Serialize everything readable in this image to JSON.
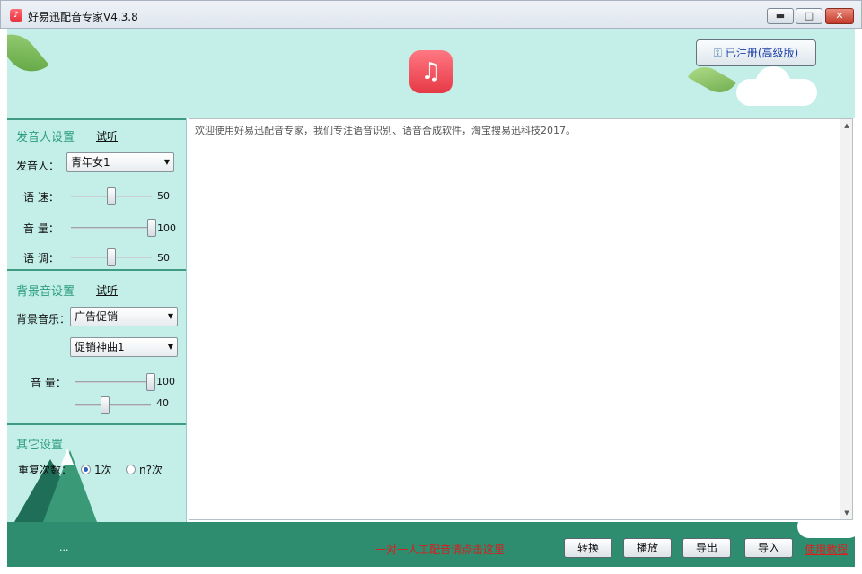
{
  "window": {
    "title": "好易迅配音专家V4.3.8",
    "controls": {
      "minimize": "▬",
      "maximize": "□",
      "close": "✕"
    }
  },
  "header": {
    "logo_icon": "music-note-icon",
    "logo_glyph": "♫",
    "register_label": "已注册(高级版)",
    "register_icon": "key-icon"
  },
  "voice_settings": {
    "title": "发音人设置",
    "trial_label": "试听",
    "speaker_label": "发音人：",
    "speaker_value": "青年女1",
    "speed": {
      "label": "语 速：",
      "value": "50",
      "level": 0.5
    },
    "volume": {
      "label": "音 量：",
      "value": "100",
      "level": 1.0
    },
    "pitch": {
      "label": "语 调：",
      "value": "50",
      "level": 0.5
    }
  },
  "bgm_settings": {
    "title": "背景音设置",
    "trial_label": "试听",
    "music_label": "背景音乐：",
    "category_value": "广告促销",
    "track_value": "促销神曲1",
    "volume_label": "音 量：",
    "volume": {
      "value": "100",
      "level": 1.0
    },
    "second": {
      "value": "40",
      "level": 0.4
    }
  },
  "other_settings": {
    "title": "其它设置",
    "repeat_label": "重复次数：",
    "options": [
      {
        "label": "1次",
        "selected": true
      },
      {
        "label": "n?次",
        "selected": false
      }
    ]
  },
  "editor": {
    "text": "欢迎使用好易迅配音专家，我们专注语音识别、语音合成软件，淘宝搜易迅科技2017。",
    "scroll_up": "▲",
    "scroll_down": "▼"
  },
  "footer": {
    "status": "...",
    "center_link": "一对一人工配音请点击这里",
    "buttons": {
      "convert": "转换",
      "play": "播放",
      "export": "导出",
      "import": "导入"
    },
    "tutorial": "使用教程"
  },
  "colors": {
    "panel_bg": "#c3efe8",
    "accent_green": "#2c9c7c",
    "footer_bg": "#2f8d6f",
    "link_red": "#e01e1e"
  }
}
